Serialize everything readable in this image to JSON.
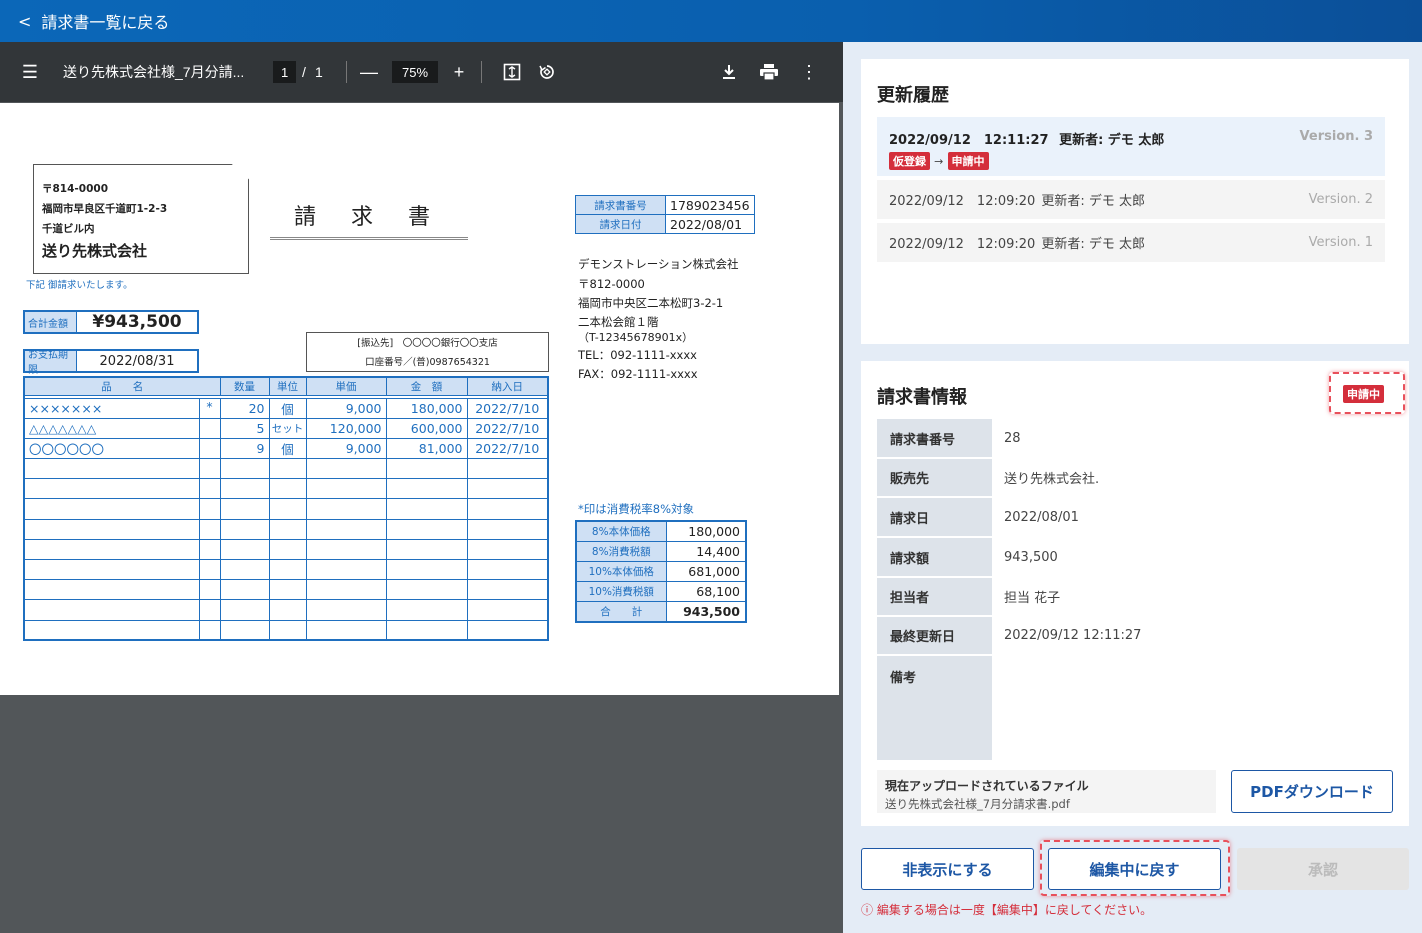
{
  "topbar": {
    "back_label": "請求書一覧に戻る"
  },
  "pdf_toolbar": {
    "filename": "送り先株式会社様_7月分請...",
    "page_current": "1",
    "page_sep": "/",
    "page_total": "1",
    "zoom": "75%"
  },
  "invoice": {
    "postal": "〒814-0000",
    "address1": "福岡市早良区千道町1-2-3",
    "address2": "千道ビル内",
    "recipient": "送り先株式会社",
    "note_below": "下記 御請求いたします。",
    "title": "請 求 書",
    "total_label": "合計金額",
    "total_value": "¥943,500",
    "due_label": "お支払期限",
    "due_value": "2022/08/31",
    "bank_line1": "[振込先]　〇〇〇〇銀行〇〇支店",
    "bank_line2": "口座番号／(普)0987654321",
    "meta": [
      {
        "label": "請求書番号",
        "value": "1789023456"
      },
      {
        "label": "請求日付",
        "value": "2022/08/01"
      }
    ],
    "issuer": {
      "name": "デモンストレーション株式会社",
      "postal": "〒812-0000",
      "address1": "福岡市中央区二本松町3-2-1",
      "address2": "二本松会館１階",
      "reg": "（T-12345678901x）",
      "tel": "TEL：092-1111-xxxx",
      "fax": "FAX：092-1111-xxxx"
    },
    "columns": [
      "品　　名",
      "数量",
      "単位",
      "単価",
      "金　額",
      "納入日"
    ],
    "rows": [
      {
        "name": "×××××××",
        "mark": "*",
        "qty": "20",
        "unit": "個",
        "price": "9,000",
        "amount": "180,000",
        "date": "2022/7/10"
      },
      {
        "name": "△△△△△△△",
        "mark": "",
        "qty": "5",
        "unit": "セット",
        "price": "120,000",
        "amount": "600,000",
        "date": "2022/7/10"
      },
      {
        "name": "〇〇〇〇〇〇",
        "mark": "",
        "qty": "9",
        "unit": "個",
        "price": "9,000",
        "amount": "81,000",
        "date": "2022/7/10"
      }
    ],
    "tax_note": "*印は消費税率8%対象",
    "tax": [
      {
        "label": "8%本体価格",
        "value": "180,000"
      },
      {
        "label": "8%消費税額",
        "value": "14,400"
      },
      {
        "label": "10%本体価格",
        "value": "681,000"
      },
      {
        "label": "10%消費税額",
        "value": "68,100"
      },
      {
        "label": "合　　計",
        "value": "943,500"
      }
    ]
  },
  "history": {
    "title": "更新履歴",
    "entries": [
      {
        "datetime": "2022/09/12　12:11:27",
        "editor": "更新者: デモ 太郎",
        "version": "Version. 3",
        "from": "仮登録",
        "arrow": "→",
        "to": "申請中"
      },
      {
        "datetime": "2022/09/12　12:09:20",
        "editor": "更新者: デモ 太郎",
        "version": "Version. 2"
      },
      {
        "datetime": "2022/09/12　12:09:20",
        "editor": "更新者: デモ 太郎",
        "version": "Version. 1"
      }
    ]
  },
  "info": {
    "title": "請求書情報",
    "status": "申請中",
    "rows": [
      {
        "key": "請求書番号",
        "value": "28"
      },
      {
        "key": "販売先",
        "value": "送り先株式会社."
      },
      {
        "key": "請求日",
        "value": "2022/08/01"
      },
      {
        "key": "請求額",
        "value": "943,500"
      },
      {
        "key": "担当者",
        "value": "担当 花子"
      },
      {
        "key": "最終更新日",
        "value": "2022/09/12 12:11:27"
      },
      {
        "key": "備考",
        "value": ""
      }
    ],
    "file_label": "現在アップロードされているファイル",
    "file_name": "送り先株式会社様_7月分請求書.pdf",
    "pdf_button": "PDFダウンロード"
  },
  "actions": {
    "hide": "非表示にする",
    "revert": "編集中に戻す",
    "approve": "承認",
    "warning": "ⓘ 編集する場合は一度【編集中】に戻してください。"
  },
  "colors": {
    "accent": "#1d57a5",
    "status_red": "#d42e3b",
    "highlight": "#e8505b"
  }
}
